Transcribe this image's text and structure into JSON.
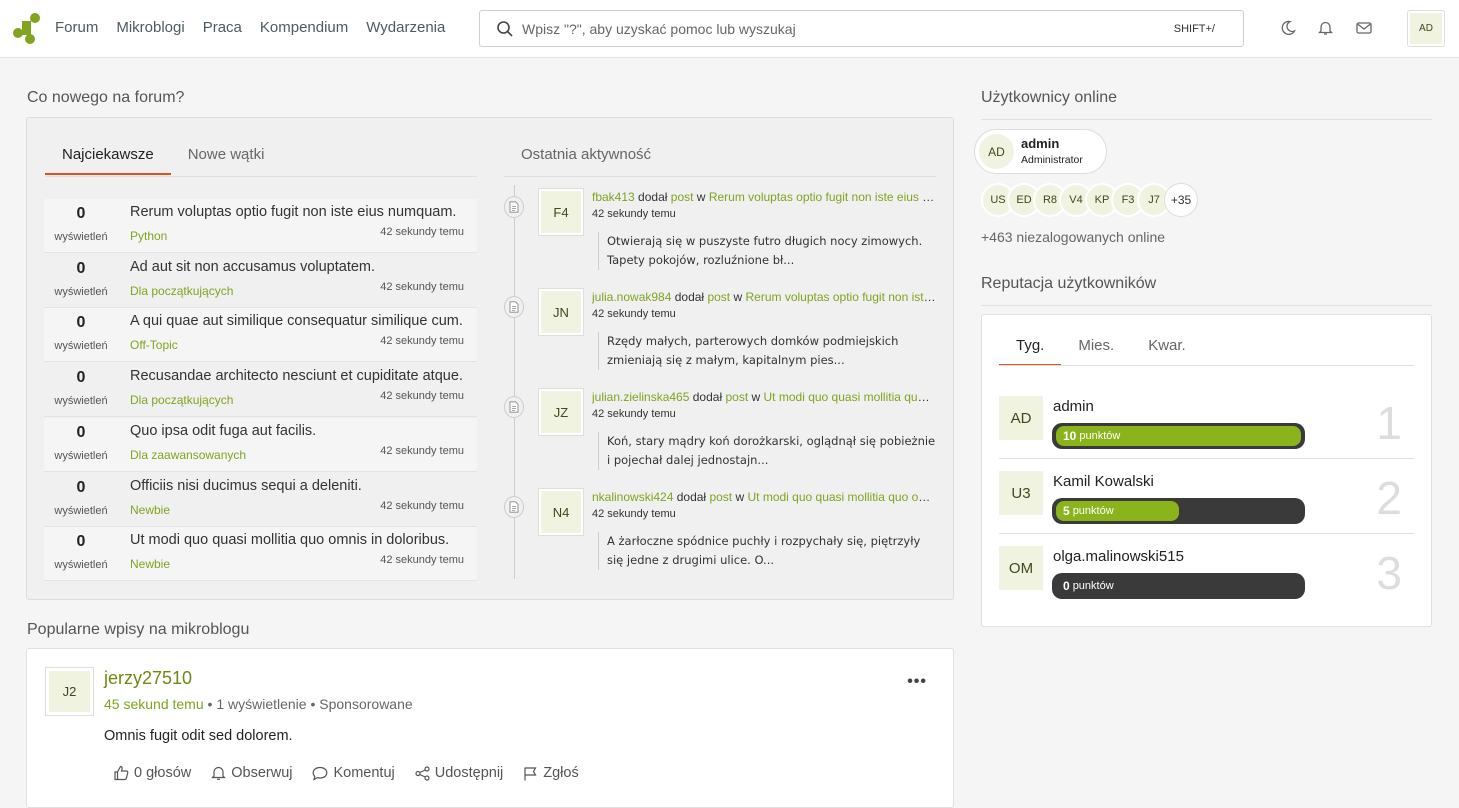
{
  "nav": {
    "items": [
      "Forum",
      "Mikroblogi",
      "Praca",
      "Kompendium",
      "Wydarzenia"
    ],
    "search_placeholder": "Wpisz \"?\", aby uzyskać pomoc lub wyszukaj",
    "search_shortcut": "SHIFT+/",
    "user_initials": "AD"
  },
  "forum": {
    "title": "Co nowego na forum?",
    "tabs": [
      "Najciekawsze",
      "Nowe wątki"
    ],
    "activity_title": "Ostatnia aktywność",
    "views_label": "wyświetleń",
    "topics": [
      {
        "count": "0",
        "title": "Rerum voluptas optio fugit non iste eius numquam.",
        "category": "Python",
        "time": "42 sekundy temu"
      },
      {
        "count": "0",
        "title": "Ad aut sit non accusamus voluptatem.",
        "category": "Dla początkujących",
        "time": "42 sekundy temu"
      },
      {
        "count": "0",
        "title": "A qui quae aut similique consequatur similique cum.",
        "category": "Off-Topic",
        "time": "42 sekundy temu"
      },
      {
        "count": "0",
        "title": "Recusandae architecto nesciunt et cupiditate atque.",
        "category": "Dla początkujących",
        "time": "42 sekundy temu"
      },
      {
        "count": "0",
        "title": "Quo ipsa odit fuga aut facilis.",
        "category": "Dla zaawansowanych",
        "time": "42 sekundy temu"
      },
      {
        "count": "0",
        "title": "Officiis nisi ducimus sequi a deleniti.",
        "category": "Newbie",
        "time": "42 sekundy temu"
      },
      {
        "count": "0",
        "title": "Ut modi quo quasi mollitia quo omnis in doloribus.",
        "category": "Newbie",
        "time": "42 sekundy temu"
      }
    ],
    "activity": [
      {
        "initials": "F4",
        "user": "fbak413",
        "verb": "dodał",
        "type": "post",
        "prep": "w",
        "topic": "Rerum voluptas optio fugit non iste eius numquam.",
        "time": "42 sekundy temu",
        "excerpt": "Otwierają się w puszyste futro długich nocy zimowych. Tapety pokojów, rozluźnione bł..."
      },
      {
        "initials": "JN",
        "user": "julia.nowak984",
        "verb": "dodał",
        "type": "post",
        "prep": "w",
        "topic": "Rerum voluptas optio fugit non iste eius numquam.",
        "time": "42 sekundy temu",
        "excerpt": "Rzędy małych, parterowych domków podmiejskich zmieniają się z małym, kapitalnym pies..."
      },
      {
        "initials": "JZ",
        "user": "julian.zielinska465",
        "verb": "dodał",
        "type": "post",
        "prep": "w",
        "topic": "Ut modi quo quasi mollitia quo omnis in doloribus.",
        "time": "42 sekundy temu",
        "excerpt": "Koń, stary mądry koń dorożkarski, oglądnął się pobieżnie i pojechał dalej jednostajn..."
      },
      {
        "initials": "N4",
        "user": "nkalinowski424",
        "verb": "dodał",
        "type": "post",
        "prep": "w",
        "topic": "Ut modi quo quasi mollitia quo omnis in doloribus.",
        "time": "42 sekundy temu",
        "excerpt": "A żarłoczne spódnice puchły i rozpychały się, piętrzyły się jedne z drugimi ulice. O..."
      }
    ]
  },
  "microblog": {
    "title": "Popularne wpisy na mikroblogu",
    "initials": "J2",
    "author": "jerzy27510",
    "time": "45 sekund temu",
    "views": "1 wyświetlenie",
    "sponsored": "Sponsorowane",
    "body": "Omnis fugit odit sed dolorem.",
    "actions": [
      "0 głosów",
      "Obserwuj",
      "Komentuj",
      "Udostępnij",
      "Zgłoś"
    ]
  },
  "online": {
    "title": "Użytkownicy online",
    "featured": {
      "initials": "AD",
      "name": "admin",
      "role": "Administrator"
    },
    "chips": [
      "US",
      "ED",
      "R8",
      "V4",
      "KP",
      "F3",
      "J7"
    ],
    "more": "+35",
    "guests": "+463 niezalogowanych online"
  },
  "reputation": {
    "title": "Reputacja użytkowników",
    "tabs": [
      "Tyg.",
      "Mies.",
      "Kwar."
    ],
    "users": [
      {
        "initials": "AD",
        "name": "admin",
        "points": "10",
        "unit": "punktów",
        "fraction": 1.0,
        "rank": "1"
      },
      {
        "initials": "U3",
        "name": "Kamil Kowalski",
        "points": "5",
        "unit": "punktów",
        "fraction": 0.5,
        "rank": "2"
      },
      {
        "initials": "OM",
        "name": "olga.malinowski515",
        "points": "0",
        "unit": "punktów",
        "fraction": 0.0,
        "rank": "3"
      }
    ]
  }
}
